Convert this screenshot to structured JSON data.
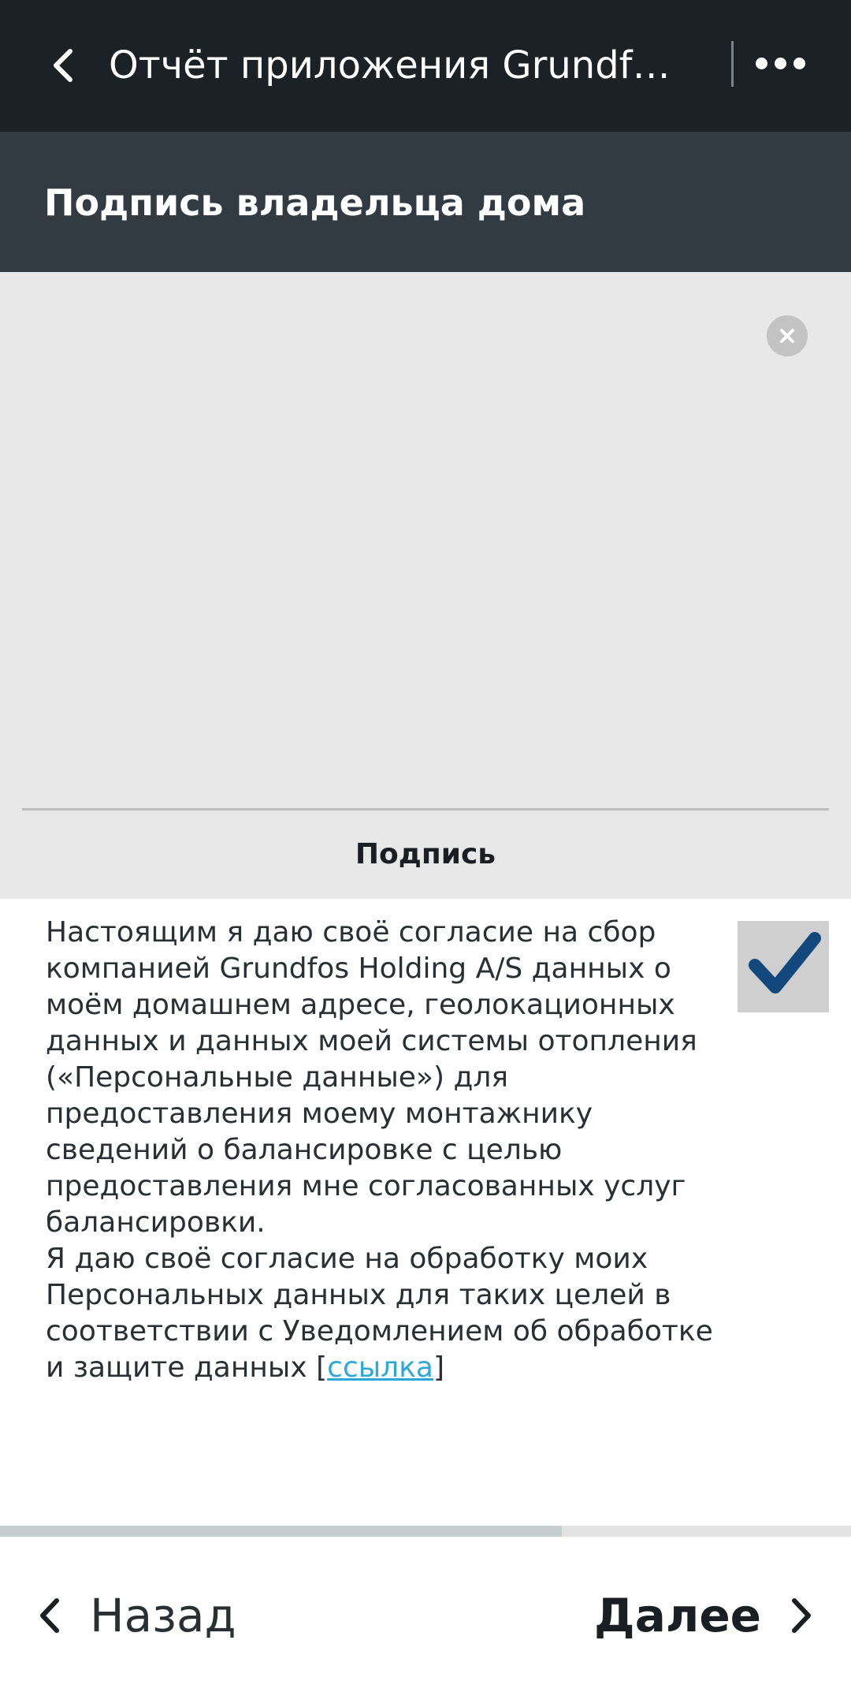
{
  "header": {
    "title": "Отчёт приложения Grundfos G..."
  },
  "section": {
    "title": "Подпись владельца дома"
  },
  "signature": {
    "label": "Подпись"
  },
  "consent": {
    "text": "Настоящим я даю своё согласие на сбор компанией Grundfos Holding A/S данных о моём домашнем адресе, геолокационных данных и данных моей системы отопления («Персональные данные») для предоставления моему монтажнику сведений о балансировке с целью предоставления мне согласованных услуг балансировки.\nЯ даю своё согласие на обработку моих Персональных данных для таких целей в соответствии с Уведомлением об обработке и защите данных [",
    "link_text": "ссылка",
    "suffix": "]",
    "checked": true
  },
  "progress": {
    "fraction": 0.66
  },
  "footer": {
    "back_label": "Назад",
    "next_label": "Далее"
  },
  "icons": {
    "back": "chevron-left-icon",
    "more": "more-horizontal-icon",
    "clear": "close-icon",
    "check": "checkmark-icon",
    "next": "chevron-right-icon"
  },
  "colors": {
    "topbar": "#1c2126",
    "section_header": "#323a42",
    "signature_bg": "#e8e8e8",
    "link": "#2ea8d8",
    "check": "#12487b"
  }
}
